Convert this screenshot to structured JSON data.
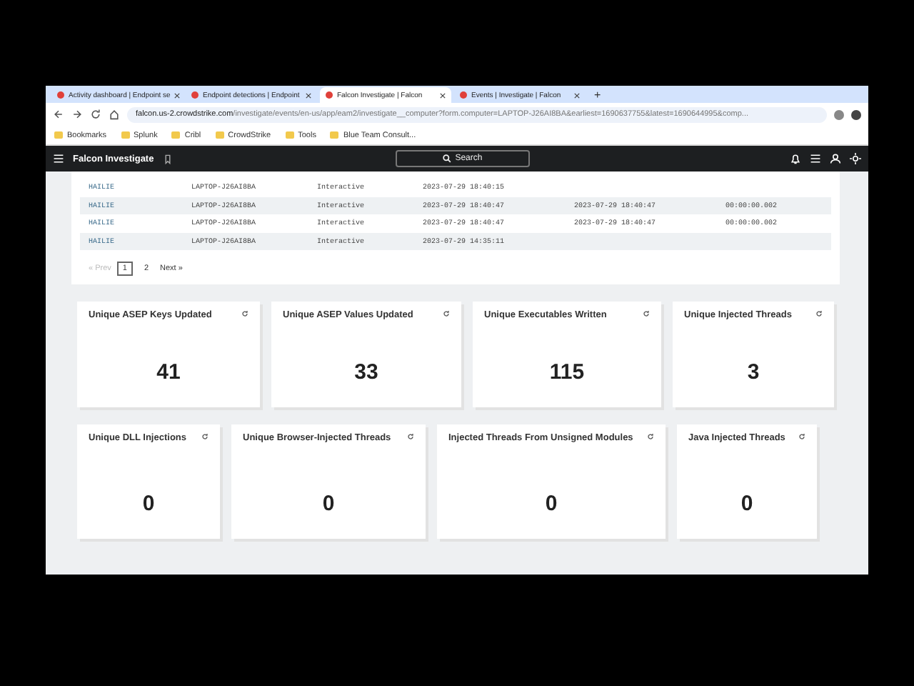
{
  "browser": {
    "tabs": [
      {
        "label": "Activity dashboard | Endpoint se",
        "selected": false
      },
      {
        "label": "Endpoint detections | Endpoint",
        "selected": false
      },
      {
        "label": "Falcon Investigate | Falcon",
        "selected": true
      },
      {
        "label": "Events | Investigate | Falcon",
        "selected": false
      }
    ],
    "new_tab": "+",
    "url_host": "falcon.us-2.crowdstrike.com",
    "url_path": "/investigate/events/en-us/app/eam2/investigate__computer?form.computer=LAPTOP-J26AI8BA&earliest=1690637755&latest=1690644995&comp...",
    "bookmarks": [
      "Bookmarks",
      "Splunk",
      "Cribl",
      "CrowdStrike",
      "Tools",
      "Blue Team Consult..."
    ]
  },
  "app": {
    "title": "Falcon Investigate",
    "search": {
      "placeholder": "Search"
    }
  },
  "table": {
    "rows": [
      [
        "HAILIE",
        "LAPTOP-J26AI8BA",
        "Interactive",
        "2023-07-29 18:40:15"
      ],
      [
        "HAILIE",
        "LAPTOP-J26AI8BA",
        "Interactive",
        "2023-07-29 18:40:47",
        "2023-07-29 18:40:47",
        "00:00:00.002"
      ],
      [
        "HAILIE",
        "LAPTOP-J26AI8BA",
        "Interactive",
        "2023-07-29 18:40:47",
        "2023-07-29 18:40:47",
        "00:00:00.002"
      ],
      [
        "HAILIE",
        "LAPTOP-J26AI8BA",
        "Interactive",
        "2023-07-29 14:35:11"
      ]
    ],
    "pagination": {
      "prev": {
        "label": "« Prev",
        "disabled": true
      },
      "pages": [
        {
          "label": "1",
          "selected": true
        },
        {
          "label": "2",
          "selected": false
        }
      ],
      "next": {
        "label": "Next »",
        "disabled": false
      }
    }
  },
  "card_rows": [
    [
      {
        "title": "Unique ASEP Keys Updated",
        "value": "41"
      },
      {
        "title": "Unique ASEP Values Updated",
        "value": "33"
      },
      {
        "title": "Unique Executables Written",
        "value": "115"
      },
      {
        "title": "Unique Injected Threads",
        "value": "3"
      }
    ],
    [
      {
        "title": "Unique DLL Injections",
        "value": "0"
      },
      {
        "title": "Unique Browser-Injected Threads",
        "value": "0"
      },
      {
        "title": "Injected Threads From Unsigned Modules",
        "value": "0"
      },
      {
        "title": "Java Injected Threads",
        "value": "0"
      }
    ]
  ]
}
